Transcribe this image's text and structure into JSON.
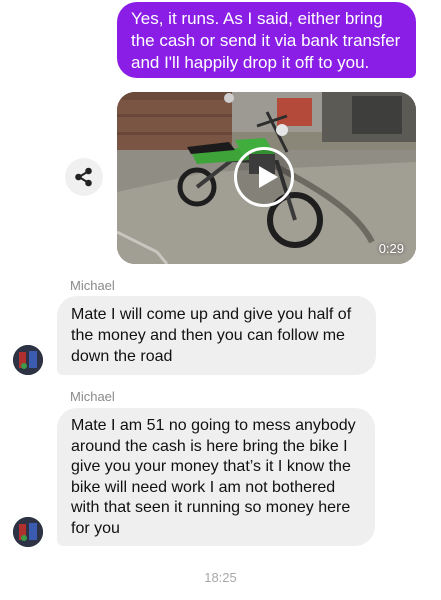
{
  "messages": {
    "outgoing_text": "Yes, it runs. As I said, either bring the cash or send it via bank transfer and I'll happily drop it off to you.",
    "video": {
      "duration": "0:29",
      "play_icon": "play-icon",
      "share_icon": "share-icon"
    },
    "incoming": [
      {
        "sender": "Michael",
        "text": "Mate I will come up and give you half of the money and then you can follow me down the road"
      },
      {
        "sender": "Michael",
        "text": "Mate I am 51 no going to mess anybody around the cash is here bring the bike I give you your money that’s it I know the bike will need work I am not bothered with that seen it running so money here for you"
      }
    ],
    "timestamp": "18:25"
  },
  "colors": {
    "outgoing_bubble": "#8a1ee6",
    "incoming_bubble": "#efefef",
    "sender_label": "#8a8a8a"
  }
}
